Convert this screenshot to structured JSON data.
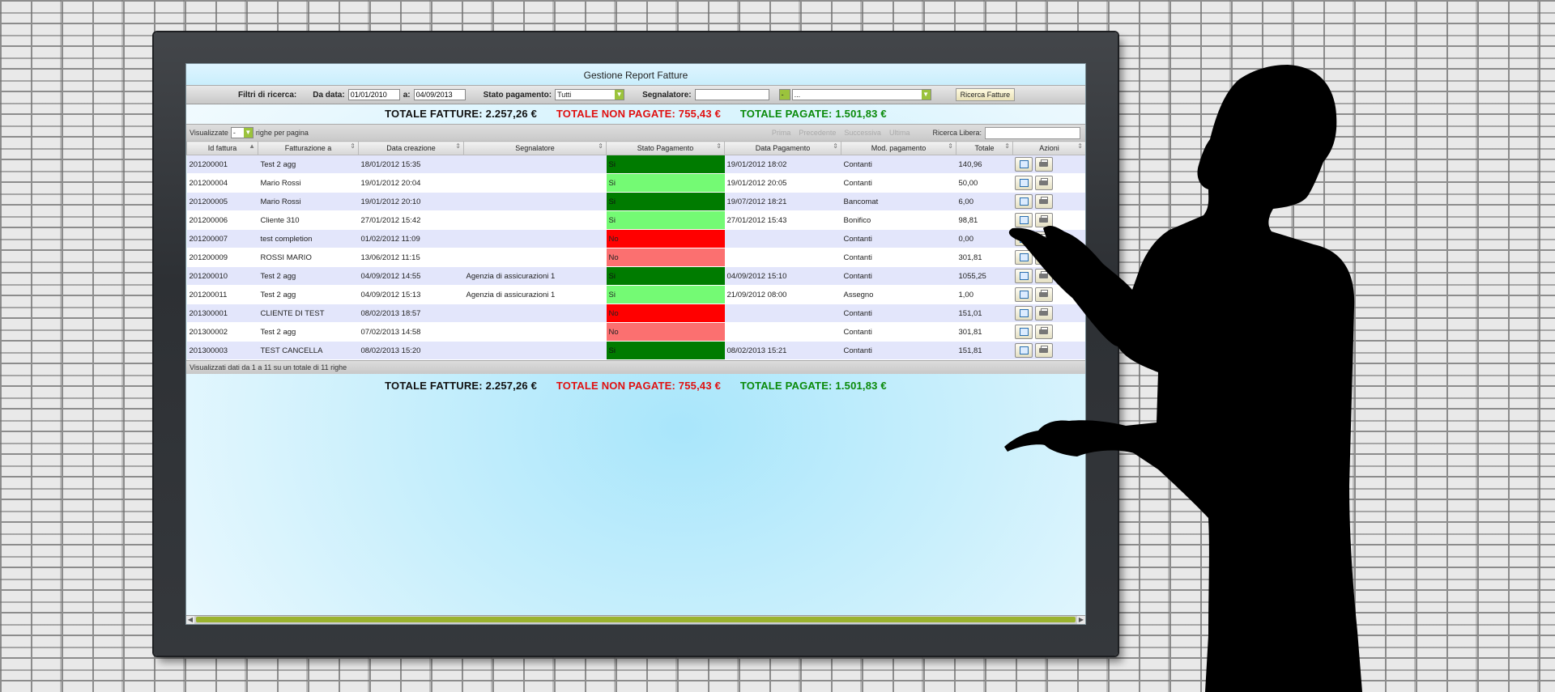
{
  "app": {
    "title": "Gestione Report Fatture"
  },
  "filters": {
    "label": "Filtri di ricerca:",
    "from_label": "Da data:",
    "from_value": "01/01/2010",
    "to_label": "a:",
    "to_value": "04/09/2013",
    "status_label": "Stato pagamento:",
    "status_value": "Tutti",
    "reporter_label": "Segnalatore:",
    "reporter_value": "",
    "reporter_select_prefix": "-",
    "reporter_select_value": "...",
    "search_button": "Ricerca Fatture"
  },
  "totals": {
    "all": "TOTALE FATTURE: 2.257,26 €",
    "unpaid": "TOTALE NON PAGATE: 755,43 €",
    "paid": "TOTALE PAGATE: 1.501,83 €"
  },
  "grid_toolbar": {
    "show_label": "Visualizzate",
    "page_size_value": "-",
    "rows_per_page": "righe per pagina",
    "first": "Prima",
    "prev": "Precedente",
    "next": "Successiva",
    "last": "Ultima",
    "free_search_label": "Ricerca Libera:"
  },
  "columns": [
    "Id fattura",
    "Fatturazione a",
    "Data creazione",
    "Segnalatore",
    "Stato Pagamento",
    "Data Pagamento",
    "Mod. pagamento",
    "Totale",
    "Azioni"
  ],
  "rows": [
    {
      "id": "201200001",
      "to": "Test 2 agg",
      "created": "18/01/2012 15:35",
      "reporter": "",
      "status": "Si",
      "status_style": "st-si-dark",
      "paid_on": "19/01/2012 18:02",
      "mode": "Contanti",
      "total": "140,96"
    },
    {
      "id": "201200004",
      "to": "Mario Rossi",
      "created": "19/01/2012 20:04",
      "reporter": "",
      "status": "Si",
      "status_style": "st-si-light",
      "paid_on": "19/01/2012 20:05",
      "mode": "Contanti",
      "total": "50,00"
    },
    {
      "id": "201200005",
      "to": "Mario Rossi",
      "created": "19/01/2012 20:10",
      "reporter": "",
      "status": "Si",
      "status_style": "st-si-dark",
      "paid_on": "19/07/2012 18:21",
      "mode": "Bancomat",
      "total": "6,00"
    },
    {
      "id": "201200006",
      "to": "Cliente 310",
      "created": "27/01/2012 15:42",
      "reporter": "",
      "status": "Si",
      "status_style": "st-si-light",
      "paid_on": "27/01/2012 15:43",
      "mode": "Bonifico",
      "total": "98,81"
    },
    {
      "id": "201200007",
      "to": "test completion",
      "created": "01/02/2012 11:09",
      "reporter": "",
      "status": "No",
      "status_style": "st-no-dark",
      "paid_on": "",
      "mode": "Contanti",
      "total": "0,00"
    },
    {
      "id": "201200009",
      "to": "ROSSI MARIO",
      "created": "13/06/2012 11:15",
      "reporter": "",
      "status": "No",
      "status_style": "st-no-light",
      "paid_on": "",
      "mode": "Contanti",
      "total": "301,81"
    },
    {
      "id": "201200010",
      "to": "Test 2 agg",
      "created": "04/09/2012 14:55",
      "reporter": "Agenzia di assicurazioni 1",
      "status": "Si",
      "status_style": "st-si-dark",
      "paid_on": "04/09/2012 15:10",
      "mode": "Contanti",
      "total": "1055,25"
    },
    {
      "id": "201200011",
      "to": "Test 2 agg",
      "created": "04/09/2012 15:13",
      "reporter": "Agenzia di assicurazioni 1",
      "status": "Si",
      "status_style": "st-si-light",
      "paid_on": "21/09/2012 08:00",
      "mode": "Assegno",
      "total": "1,00"
    },
    {
      "id": "201300001",
      "to": "CLIENTE DI TEST",
      "created": "08/02/2013 18:57",
      "reporter": "",
      "status": "No",
      "status_style": "st-no-dark",
      "paid_on": "",
      "mode": "Contanti",
      "total": "151,01"
    },
    {
      "id": "201300002",
      "to": "Test 2 agg",
      "created": "07/02/2013 14:58",
      "reporter": "",
      "status": "No",
      "status_style": "st-no-light",
      "paid_on": "",
      "mode": "Contanti",
      "total": "301,81"
    },
    {
      "id": "201300003",
      "to": "TEST CANCELLA",
      "created": "08/02/2013 15:20",
      "reporter": "",
      "status": "Si",
      "status_style": "st-si-dark",
      "paid_on": "08/02/2013 15:21",
      "mode": "Contanti",
      "total": "151,81"
    }
  ],
  "grid_footer": "Visualizzati dati da 1 a 11 su un totale di 11 righe",
  "colors": {
    "paid_dark": "#007b00",
    "paid_light": "#74fa74",
    "unpaid_dark": "#ff0000",
    "unpaid_light": "#fb7070",
    "total_unpaid": "#e01010",
    "total_paid": "#0a8a0a"
  }
}
